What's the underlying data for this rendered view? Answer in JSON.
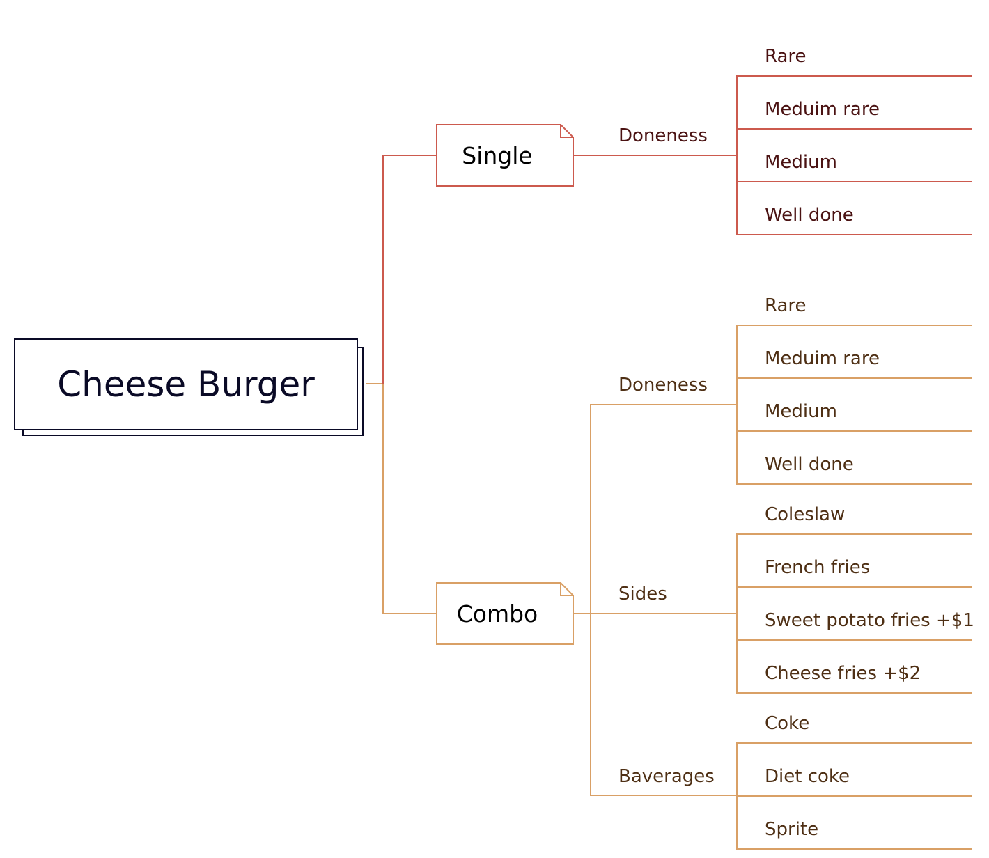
{
  "colors": {
    "single_branch": "#cc5a4e",
    "single_text": "#4a1212",
    "combo_branch": "#d9a066",
    "combo_text": "#4e2f14",
    "root_border": "#0a0a26",
    "root_text": "#0a0a26"
  },
  "root": {
    "label": "Cheese Burger"
  },
  "branches": [
    {
      "label": "Single",
      "categories": [
        {
          "label": "Doneness",
          "items": [
            "Rare",
            "Meduim rare",
            "Medium",
            "Well done"
          ]
        }
      ]
    },
    {
      "label": "Combo",
      "categories": [
        {
          "label": "Doneness",
          "items": [
            "Rare",
            "Meduim rare",
            "Medium",
            "Well done"
          ]
        },
        {
          "label": "Sides",
          "items": [
            "Coleslaw",
            "French fries",
            "Sweet potato fries +$1",
            "Cheese fries +$2"
          ]
        },
        {
          "label": "Baverages",
          "items": [
            "Coke",
            "Diet coke",
            "Sprite"
          ]
        }
      ]
    }
  ]
}
